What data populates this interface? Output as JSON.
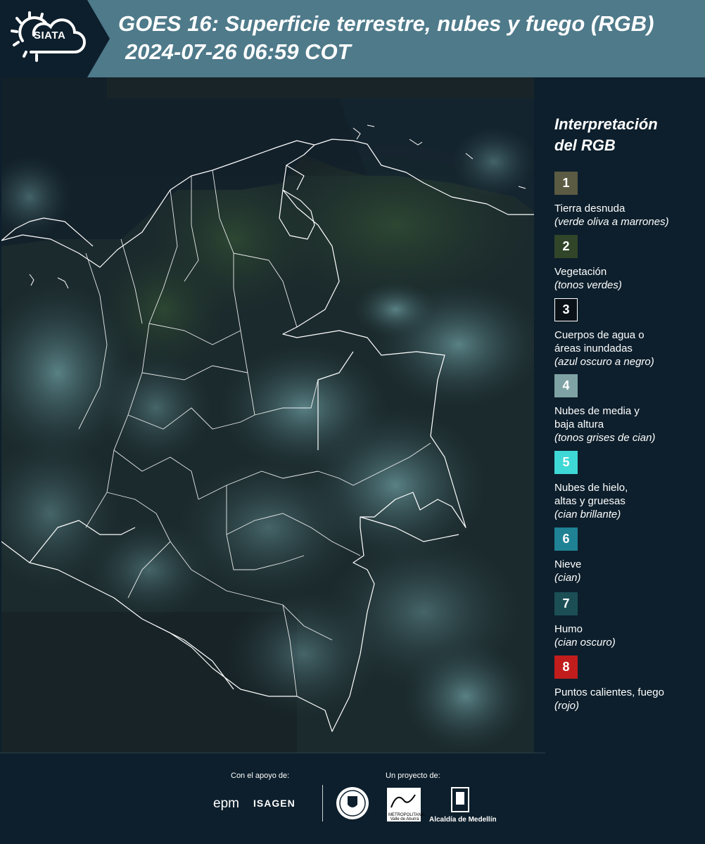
{
  "header": {
    "logo_text": "SIATA",
    "title_line1": "GOES 16: Superficie terrestre, nubes y fuego (RGB)",
    "title_line2": "2024-07-26 06:59 COT"
  },
  "map": {
    "icon": "satellite-map",
    "background_color": "#1a2a2e",
    "land_color": "#24392f",
    "cloud_color": "#5f8e92",
    "border_color": "#ffffff"
  },
  "legend": {
    "title_line1": "Interpretación",
    "title_line2": "del RGB",
    "items": [
      {
        "number": "1",
        "label": "Tierra desnuda",
        "description": "(verde oliva a marrones)",
        "color": "#5b5a43"
      },
      {
        "number": "2",
        "label": "Vegetación",
        "description": "(tonos verdes)",
        "color": "#314528"
      },
      {
        "number": "3",
        "label": "Cuerpos de agua o áreas inundadas",
        "description": "(azul oscuro a negro)",
        "color": "#0a1218"
      },
      {
        "number": "4",
        "label": "Nubes de media y baja altura",
        "description": "(tonos grises de cian)",
        "color": "#7fa3a4"
      },
      {
        "number": "5",
        "label": "Nubes de hielo, altas y gruesas",
        "description": "(cian brillante)",
        "color": "#3ed8d6"
      },
      {
        "number": "6",
        "label": "Nieve",
        "description": "(cian)",
        "color": "#1f8295"
      },
      {
        "number": "7",
        "label": "Humo",
        "description": "(cian oscuro)",
        "color": "#1b4f55"
      },
      {
        "number": "8",
        "label": "Puntos calientes, fuego",
        "description": "(rojo)",
        "color": "#c11d1d"
      }
    ]
  },
  "footer": {
    "support_label": "Con el apoyo de:",
    "project_label": "Un proyecto de:",
    "epm": "epm",
    "isagen": "ISAGEN",
    "area_label": "METROPOLITANA Valle de Aburrá",
    "alcaldia": "Alcaldía de Medellín"
  }
}
